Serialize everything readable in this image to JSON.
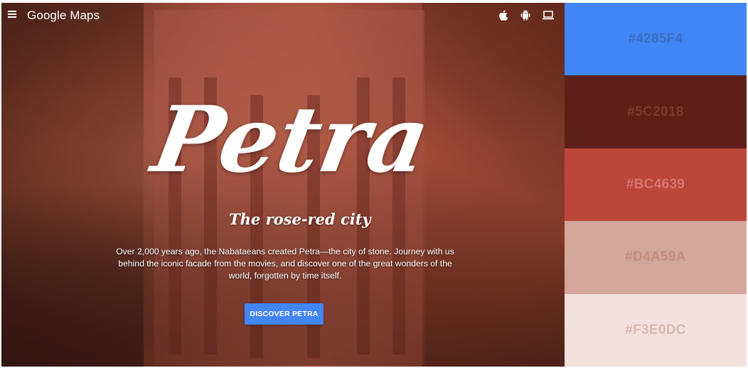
{
  "header": {
    "menu_icon": "hamburger-menu-icon",
    "brand": "Google Maps",
    "platform_icons": [
      "apple-icon",
      "android-icon",
      "laptop-icon"
    ]
  },
  "hero": {
    "title": "Petra",
    "subtitle": "The rose-red city",
    "description": "Over 2,000 years ago, the Nabataeans created Petra—the city of stone. Journey with us behind the iconic facade from the movies, and discover one of the great wonders of the world, forgotten by time itself.",
    "cta_label": "DISCOVER PETRA",
    "cta_color": "#4285F4"
  },
  "palette": [
    {
      "label": "#4285F4",
      "color": "#4285F4",
      "text_color": "#3a6fc4"
    },
    {
      "label": "#5C2018",
      "color": "#5C2018",
      "text_color": "#7a3a30"
    },
    {
      "label": "#BC4639",
      "color": "#BC4639",
      "text_color": "#d2786c"
    },
    {
      "label": "#D4A59A",
      "color": "#D4A59A",
      "text_color": "#c48e82"
    },
    {
      "label": "#F3E0DC",
      "color": "#F3E0DC",
      "text_color": "#d6b9b2"
    }
  ]
}
